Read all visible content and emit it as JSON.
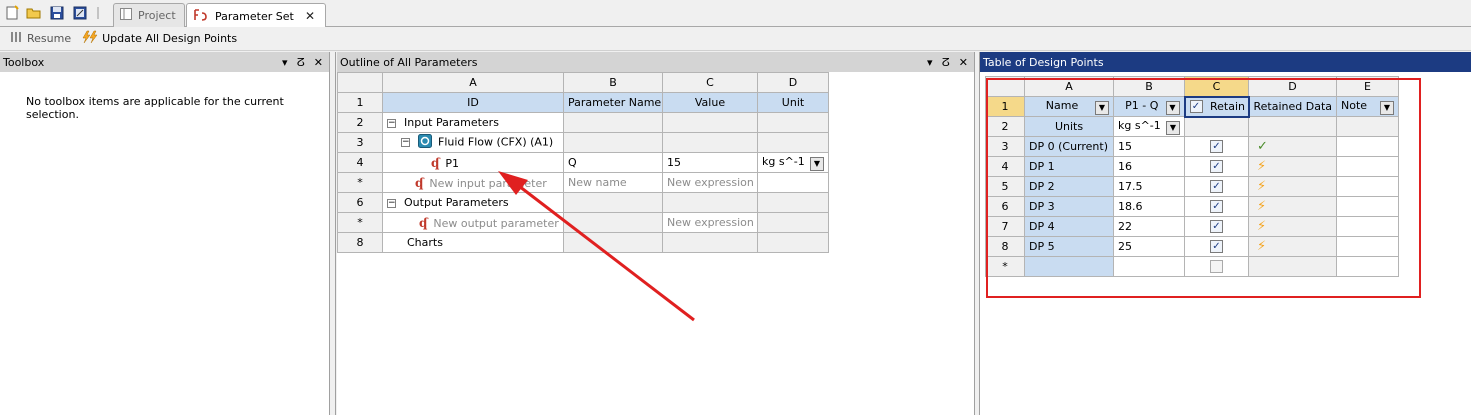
{
  "tabs": {
    "project": "Project",
    "parameter_set": "Parameter Set",
    "close_glyph": "✕"
  },
  "toolbar": {
    "resume": "Resume",
    "update_all": "Update All Design Points"
  },
  "toolbox": {
    "title": "Toolbox",
    "message": "No toolbox items are applicable for the current selection."
  },
  "panel_controls": {
    "dropdown": "▾",
    "pin": "ⵒ",
    "close": "✕"
  },
  "outline": {
    "title": "Outline of All Parameters",
    "col_letters": [
      "A",
      "B",
      "C",
      "D"
    ],
    "headers": [
      "ID",
      "Parameter Name",
      "Value",
      "Unit"
    ],
    "rows": [
      {
        "num": "2",
        "id": "Input Parameters",
        "name": "",
        "value": "",
        "unit": ""
      },
      {
        "num": "3",
        "id": "Fluid Flow (CFX) (A1)",
        "name": "",
        "value": "",
        "unit": ""
      },
      {
        "num": "4",
        "id": "P1",
        "name": "Q",
        "value": "15",
        "unit": "kg s^-1"
      },
      {
        "num": "*",
        "id": "New input parameter",
        "name": "New name",
        "value": "New expression",
        "unit": ""
      },
      {
        "num": "6",
        "id": "Output Parameters",
        "name": "",
        "value": "",
        "unit": ""
      },
      {
        "num": "*",
        "id": "New output parameter",
        "name": "",
        "value": "New expression",
        "unit": ""
      },
      {
        "num": "8",
        "id": "Charts",
        "name": "",
        "value": "",
        "unit": ""
      }
    ],
    "header_row_num": "1",
    "expander_glyph": "−"
  },
  "design_points": {
    "title": "Table of Design Points",
    "col_letters": [
      "A",
      "B",
      "C",
      "D",
      "E"
    ],
    "headers": [
      "Name",
      "P1 - Q",
      "Retain",
      "Retained Data",
      "Note"
    ],
    "header_row_num": "1",
    "units_row": {
      "num": "2",
      "label": "Units",
      "unit": "kg s^-1"
    },
    "rows": [
      {
        "num": "3",
        "name": "DP 0 (Current)",
        "q": "15",
        "retain": true,
        "status": "ok"
      },
      {
        "num": "4",
        "name": "DP 1",
        "q": "16",
        "retain": true,
        "status": "needs-update"
      },
      {
        "num": "5",
        "name": "DP 2",
        "q": "17.5",
        "retain": true,
        "status": "needs-update"
      },
      {
        "num": "6",
        "name": "DP 3",
        "q": "18.6",
        "retain": true,
        "status": "needs-update"
      },
      {
        "num": "7",
        "name": "DP 4",
        "q": "22",
        "retain": true,
        "status": "needs-update"
      },
      {
        "num": "8",
        "name": "DP 5",
        "q": "25",
        "retain": true,
        "status": "needs-update"
      }
    ],
    "new_row_num": "*",
    "glyphs": {
      "check": "✓",
      "ok": "✓",
      "lightning": "⚡",
      "dropdown": "▼"
    }
  },
  "colors": {
    "annotation_red": "#e02020",
    "active_title": "#1c3b82",
    "selected_blue": "#c9dcf1",
    "highlight_header": "#f5d98a"
  }
}
